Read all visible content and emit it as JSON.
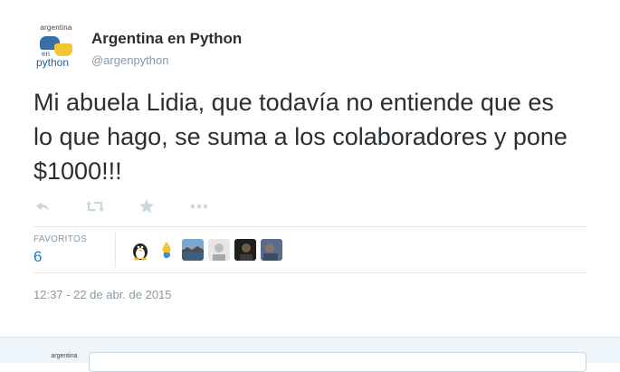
{
  "tweet": {
    "author": {
      "avatar_text_top": "argentina",
      "avatar_text_en": "en",
      "avatar_text_python": "python",
      "fullname": "Argentina en Python",
      "username": "@argenpython"
    },
    "text": "Mi abuela Lidia, que todavía no entiende que es lo que hago, se suma a los colaboradores y pone $1000!!!",
    "actions": [
      {
        "name": "reply-icon"
      },
      {
        "name": "retweet-icon"
      },
      {
        "name": "favorite-icon"
      },
      {
        "name": "more-icon"
      }
    ],
    "stats": {
      "favorites_label": "FAVORITOS",
      "favorites_count": "6",
      "favorited_by": [
        {
          "icon": "penguin-avatar",
          "color": "#ffffff"
        },
        {
          "icon": "flame-avatar",
          "color": "#ffffff"
        },
        {
          "icon": "landscape-avatar",
          "color": "#4f7ca8"
        },
        {
          "icon": "person-avatar",
          "color": "#d9d9d9"
        },
        {
          "icon": "dark-portrait-avatar",
          "color": "#2a2a2a"
        },
        {
          "icon": "photo-avatar",
          "color": "#5a6b8c"
        }
      ]
    },
    "timestamp": "12:37 - 22 de abr. de 2015"
  },
  "reply": {
    "avatar_text": "argentina"
  }
}
